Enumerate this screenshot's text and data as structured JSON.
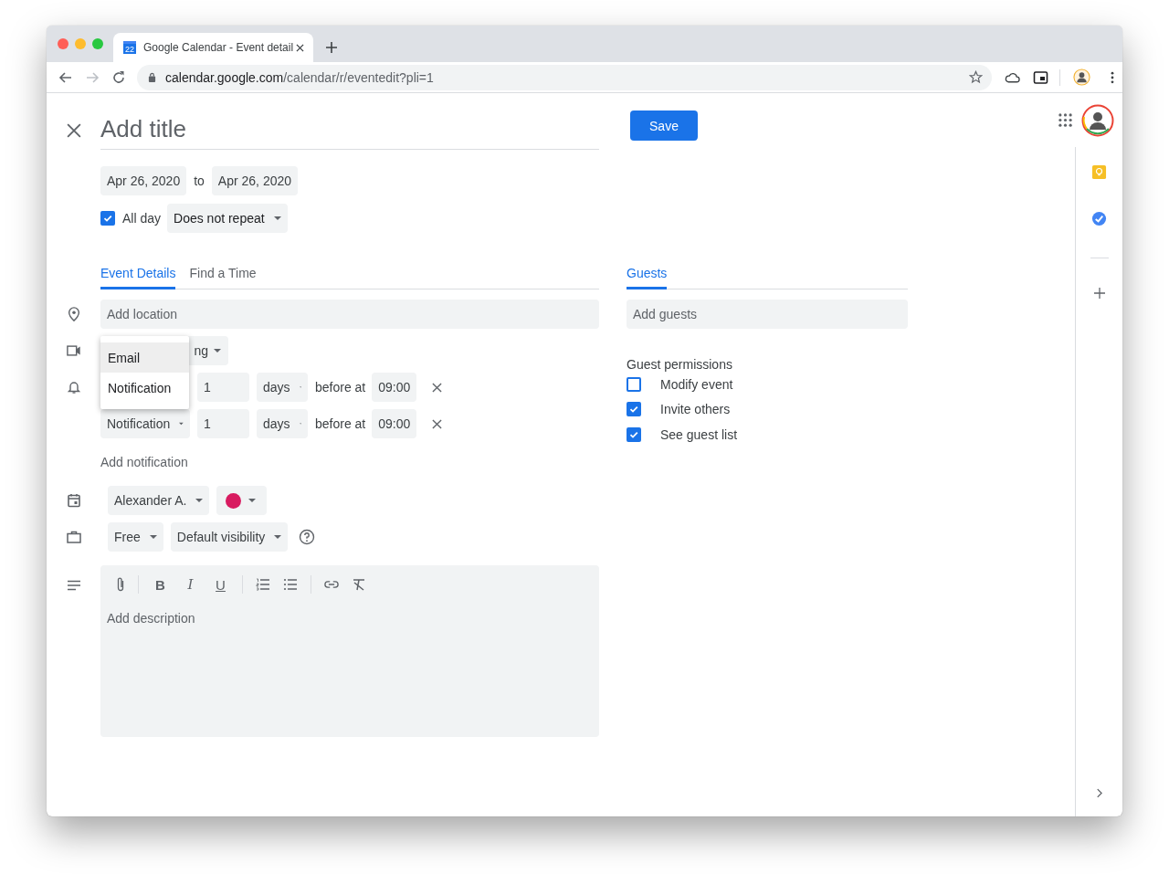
{
  "browser": {
    "tab_favicon_text": "22",
    "tab_title": "Google Calendar - Event detail",
    "url_host": "calendar.google.com",
    "url_path": "/calendar/r/eventedit?pli=1"
  },
  "event": {
    "title_placeholder": "Add title",
    "save": "Save",
    "start_date": "Apr 26, 2020",
    "to": "to",
    "end_date": "Apr 26, 2020",
    "all_day": {
      "label": "All day",
      "checked": true
    },
    "repeat": "Does not repeat"
  },
  "tabs": [
    {
      "label": "Event Details",
      "selected": true
    },
    {
      "label": "Find a Time",
      "selected": false
    }
  ],
  "location_placeholder": "Add location",
  "conferencing": "ng",
  "type_menu": [
    {
      "label": "Email",
      "selected": true
    },
    {
      "label": "Notification",
      "selected": false
    }
  ],
  "notifications": [
    {
      "amount": "1",
      "unit": "days",
      "before": "before at",
      "time": "09:00"
    },
    {
      "type": "Notification",
      "amount": "1",
      "unit": "days",
      "before": "before at",
      "time": "09:00"
    }
  ],
  "add_notification": "Add notification",
  "calendar": "Alexander A.",
  "event_color": {
    "color": "#d81b60"
  },
  "availability": "Free",
  "visibility": "Default visibility",
  "format_buttons": [
    {
      "label": "B",
      "kind": "bold"
    },
    {
      "label": "I",
      "kind": "italic"
    },
    {
      "label": "U",
      "kind": "underline"
    }
  ],
  "description_placeholder": "Add description",
  "guests": {
    "tab": {
      "label": "Guests",
      "selected": true
    },
    "placeholder": "Add guests",
    "permissions_title": "Guest permissions",
    "permissions": [
      {
        "label": "Modify event",
        "checked": false
      },
      {
        "label": "Invite others",
        "checked": true
      },
      {
        "label": "See guest list",
        "checked": true
      }
    ]
  }
}
